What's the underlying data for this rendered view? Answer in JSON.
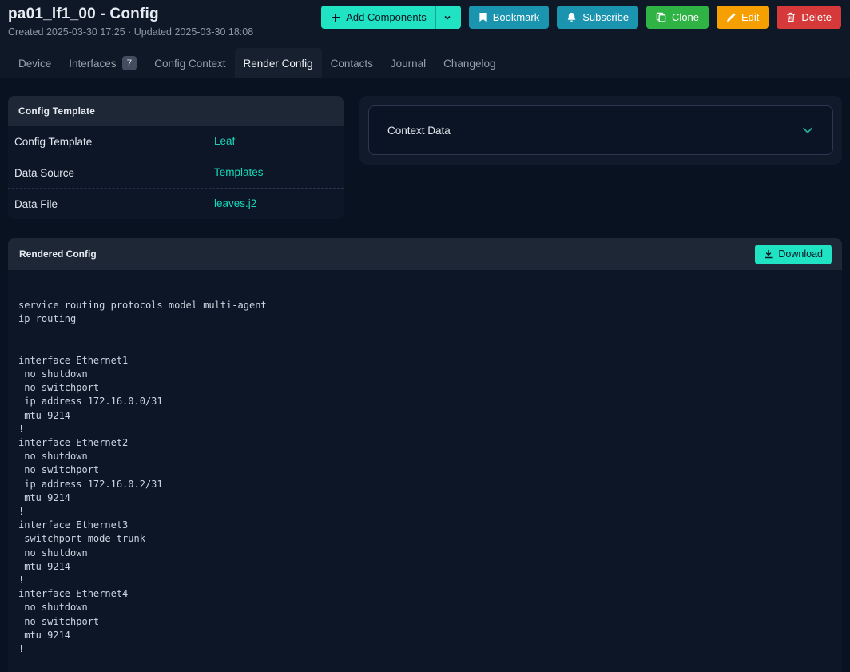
{
  "header": {
    "title": "pa01_lf1_00 - Config",
    "subtitle": "Created 2025-03-30 17:25 · Updated 2025-03-30 18:08",
    "buttons": {
      "add_components": "Add Components",
      "bookmark": "Bookmark",
      "subscribe": "Subscribe",
      "clone": "Clone",
      "edit": "Edit",
      "delete": "Delete"
    }
  },
  "tabs": [
    {
      "label": "Device",
      "active": false
    },
    {
      "label": "Interfaces",
      "badge": "7",
      "active": false
    },
    {
      "label": "Config Context",
      "active": false
    },
    {
      "label": "Render Config",
      "active": true
    },
    {
      "label": "Contacts",
      "active": false
    },
    {
      "label": "Journal",
      "active": false
    },
    {
      "label": "Changelog",
      "active": false
    }
  ],
  "config_template_card": {
    "title": "Config Template",
    "rows": [
      {
        "label": "Config Template",
        "value": "Leaf"
      },
      {
        "label": "Data Source",
        "value": "Templates"
      },
      {
        "label": "Data File",
        "value": "leaves.j2"
      }
    ]
  },
  "context_data": {
    "title": "Context Data"
  },
  "rendered_config": {
    "title": "Rendered Config",
    "download_label": "Download",
    "config_text": "service routing protocols model multi-agent\nip routing\n\n\ninterface Ethernet1\n no shutdown\n no switchport\n ip address 172.16.0.0/31\n mtu 9214\n!\ninterface Ethernet2\n no shutdown\n no switchport\n ip address 172.16.0.2/31\n mtu 9214\n!\ninterface Ethernet3\n switchport mode trunk\n no shutdown\n mtu 9214\n!\ninterface Ethernet4\n no shutdown\n no switchport\n mtu 9214\n!"
  },
  "icons": {
    "add_components": "plus",
    "add_components_caret": "chevron-down",
    "bookmark": "bookmark",
    "subscribe": "bell",
    "clone": "copy",
    "edit": "pencil",
    "delete": "trash",
    "download": "download-arrow",
    "context_toggle": "chevron-down"
  },
  "colors": {
    "bg_header": "#0f1826",
    "bg_page": "#091220",
    "bg_tab_active": "#16202e",
    "bg_card": "#0d1626",
    "bg_card_header": "#1d2736",
    "bg_context_card": "#101a2a",
    "bg_accordion": "#0a1424",
    "border_dashed": "#27334a",
    "border_accordion": "#2b3750",
    "teal": "#1fe3c2",
    "teal_link": "#18d8ba",
    "chevron_teal": "#2aa99b",
    "blue_btn": "#1b94b0",
    "green_btn": "#2fb344",
    "yellow_btn": "#f59f00",
    "red_btn": "#d63939",
    "text": "#e7ecf2",
    "text_muted": "#8c97a6",
    "tab_text": "#93a0af",
    "badge_bg": "#424e5f",
    "mono_text": "#ccd5e0"
  }
}
